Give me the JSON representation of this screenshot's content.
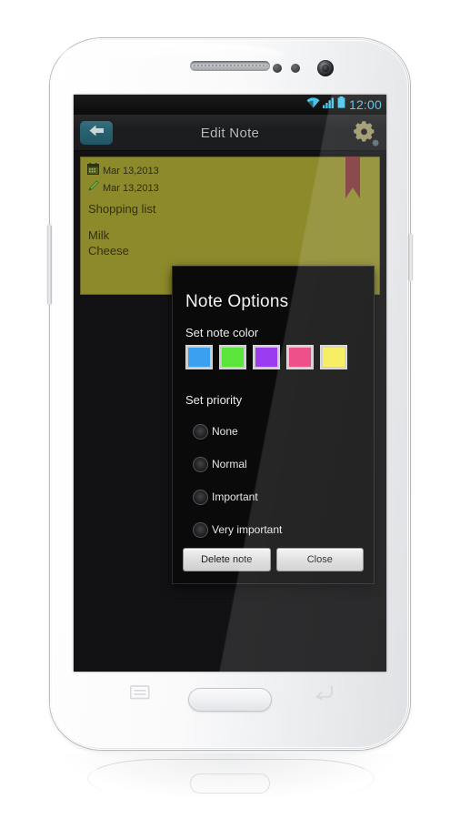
{
  "device": {
    "name": "White smartphone",
    "hardware": {
      "earpiece": "earpiece-grille",
      "front_camera": "front-camera",
      "sensors": "proximity-sensors",
      "home_button": "home-button",
      "menu_key": "menu-key",
      "back_key": "back-key",
      "volume_rocker": "volume-rocker",
      "power_button": "power-button"
    }
  },
  "statusbar": {
    "clock": "12:00",
    "clock_color": "#39c0e8",
    "icons": [
      "wifi-icon",
      "signal-icon",
      "battery-icon"
    ]
  },
  "actionbar": {
    "title": "Edit Note",
    "back_icon": "back-arrow-icon",
    "settings_icon": "gear-icon"
  },
  "note": {
    "created_icon": "calendar-icon",
    "created_date": "Mar 13,2013",
    "edited_icon": "pencil-icon",
    "edited_date": "Mar 13,2013",
    "title": "Shopping list",
    "body": "Milk\nCheese",
    "bookmark_icon": "bookmark-ribbon-icon",
    "bookmark_color": "#7d3335",
    "paper_color": "#8d8a2c"
  },
  "dialog": {
    "title": "Note Options",
    "color_section_label": "Set note color",
    "colors": [
      {
        "name": "blue",
        "hex": "#3ca0f0"
      },
      {
        "name": "green",
        "hex": "#5ae53c"
      },
      {
        "name": "purple",
        "hex": "#9b3cf0"
      },
      {
        "name": "pink",
        "hex": "#ec3b7b"
      },
      {
        "name": "yellow",
        "hex": "#f5ed52"
      }
    ],
    "priority_section_label": "Set priority",
    "priorities": [
      {
        "label": "None",
        "selected": false
      },
      {
        "label": "Normal",
        "selected": false
      },
      {
        "label": "Important",
        "selected": false
      },
      {
        "label": "Very important",
        "selected": false
      }
    ],
    "delete_label": "Delete note",
    "close_label": "Close"
  }
}
